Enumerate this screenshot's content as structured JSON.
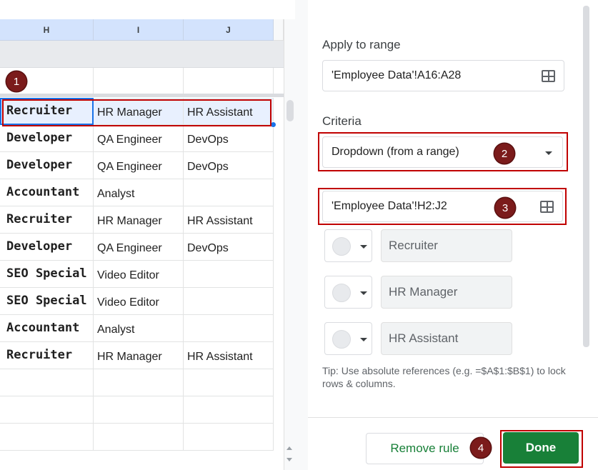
{
  "sheet": {
    "columns": [
      "H",
      "I",
      "J"
    ],
    "rows": [
      [
        "Recruiter",
        "HR Manager",
        "HR Assistant"
      ],
      [
        "Developer",
        "QA Engineer",
        "DevOps"
      ],
      [
        "Developer",
        "QA Engineer",
        "DevOps"
      ],
      [
        "Accountant",
        "Analyst",
        ""
      ],
      [
        "Recruiter",
        "HR Manager",
        "HR Assistant"
      ],
      [
        "Developer",
        "QA Engineer",
        "DevOps"
      ],
      [
        "SEO Special",
        "Video Editor",
        ""
      ],
      [
        "SEO Special",
        "Video Editor",
        ""
      ],
      [
        "Accountant",
        "Analyst",
        ""
      ],
      [
        "Recruiter",
        "HR Manager",
        "HR Assistant"
      ]
    ]
  },
  "panel": {
    "apply_label": "Apply to range",
    "apply_value": "'Employee Data'!A16:A28",
    "criteria_label": "Criteria",
    "criteria_value": "Dropdown (from a range)",
    "range_value": "'Employee Data'!H2:J2",
    "options": [
      "Recruiter",
      "HR Manager",
      "HR Assistant"
    ],
    "tip": "Tip: Use absolute references (e.g. =$A$1:$B$1) to lock rows & columns.",
    "remove_label": "Remove rule",
    "done_label": "Done"
  },
  "badges": [
    "1",
    "2",
    "3",
    "4"
  ],
  "colors": {
    "accent_green": "#188038",
    "selection_blue": "#1a73e8",
    "highlight_red": "#c00000",
    "badge": "#7b1b1b"
  }
}
